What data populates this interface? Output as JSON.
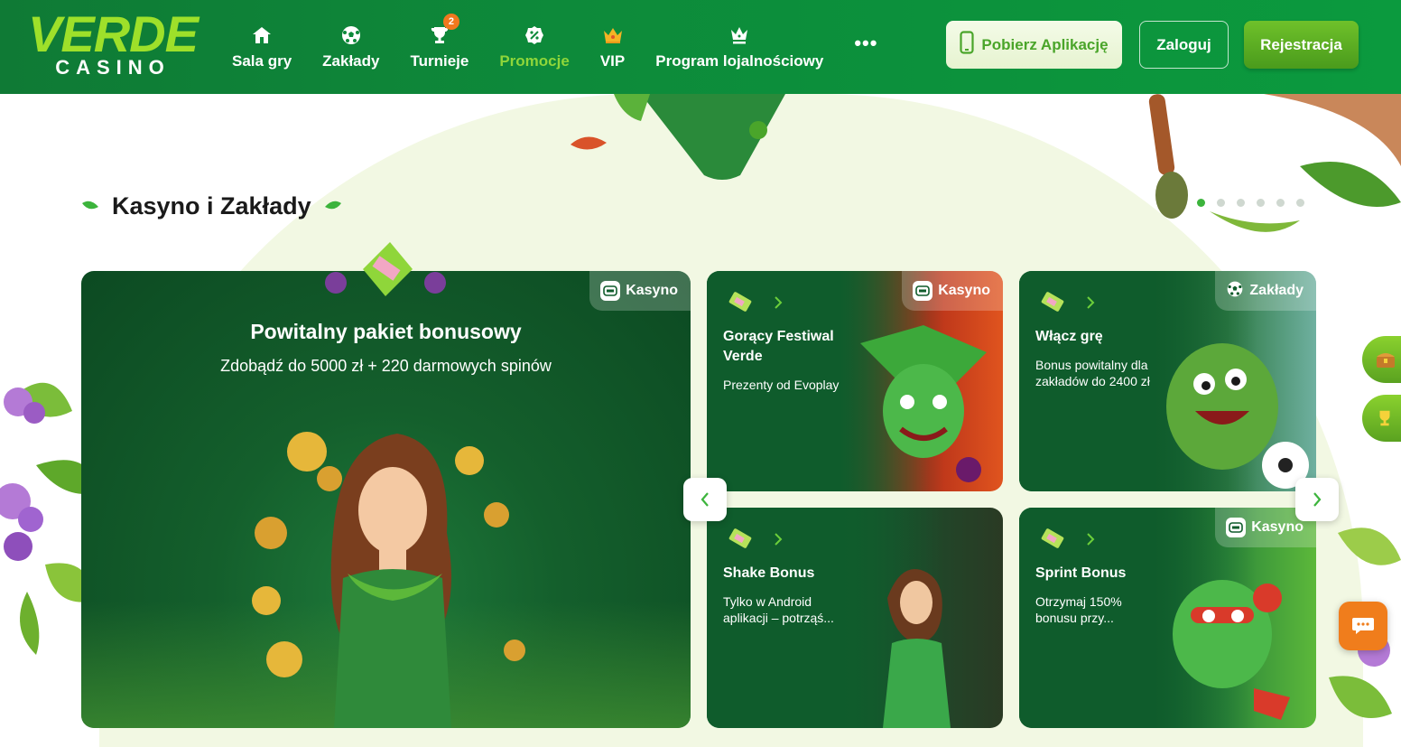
{
  "header": {
    "logo": {
      "line1": "VERDE",
      "line2": "CASINO"
    },
    "nav": [
      {
        "label": "Sala gry",
        "icon": "home-icon"
      },
      {
        "label": "Zakłady",
        "icon": "soccer-ball-icon"
      },
      {
        "label": "Turnieje",
        "icon": "trophy-icon",
        "badge": "2"
      },
      {
        "label": "Promocje",
        "icon": "percent-badge-icon",
        "active": true
      },
      {
        "label": "VIP",
        "icon": "crown-icon"
      },
      {
        "label": "Program lojalnościowy",
        "icon": "loyalty-crown-icon"
      }
    ],
    "more": "•••",
    "app_button": "Pobierz Aplikację",
    "login_button": "Zaloguj",
    "register_button": "Rejestracja"
  },
  "section": {
    "title": "Kasyno i Zakłady",
    "dots_count": 6,
    "active_dot": 0
  },
  "cards": {
    "main": {
      "tag": "Kasyno",
      "title": "Powitalny pakiet bonusowy",
      "subtitle": "Zdobądź do 5000 zł + 220 darmowych spinów"
    },
    "c1": {
      "tag": "Kasyno",
      "title": "Gorący Festiwal Verde",
      "desc": "Prezenty od Evoplay"
    },
    "c2": {
      "tag": "Zakłady",
      "title": "Włącz grę",
      "desc": "Bonus powitalny dla zakładów do 2400 zł"
    },
    "c3": {
      "title": "Shake Bonus",
      "desc": "Tylko w Android aplikacji – potrząś..."
    },
    "c4": {
      "tag": "Kasyno",
      "title": "Sprint Bonus",
      "desc": "Otrzymaj 150% bonusu przy..."
    }
  },
  "colors": {
    "header": "#0d8a3a",
    "accent": "#8fd63a",
    "card": "#0f5c2c",
    "chat": "#f07d1c"
  }
}
